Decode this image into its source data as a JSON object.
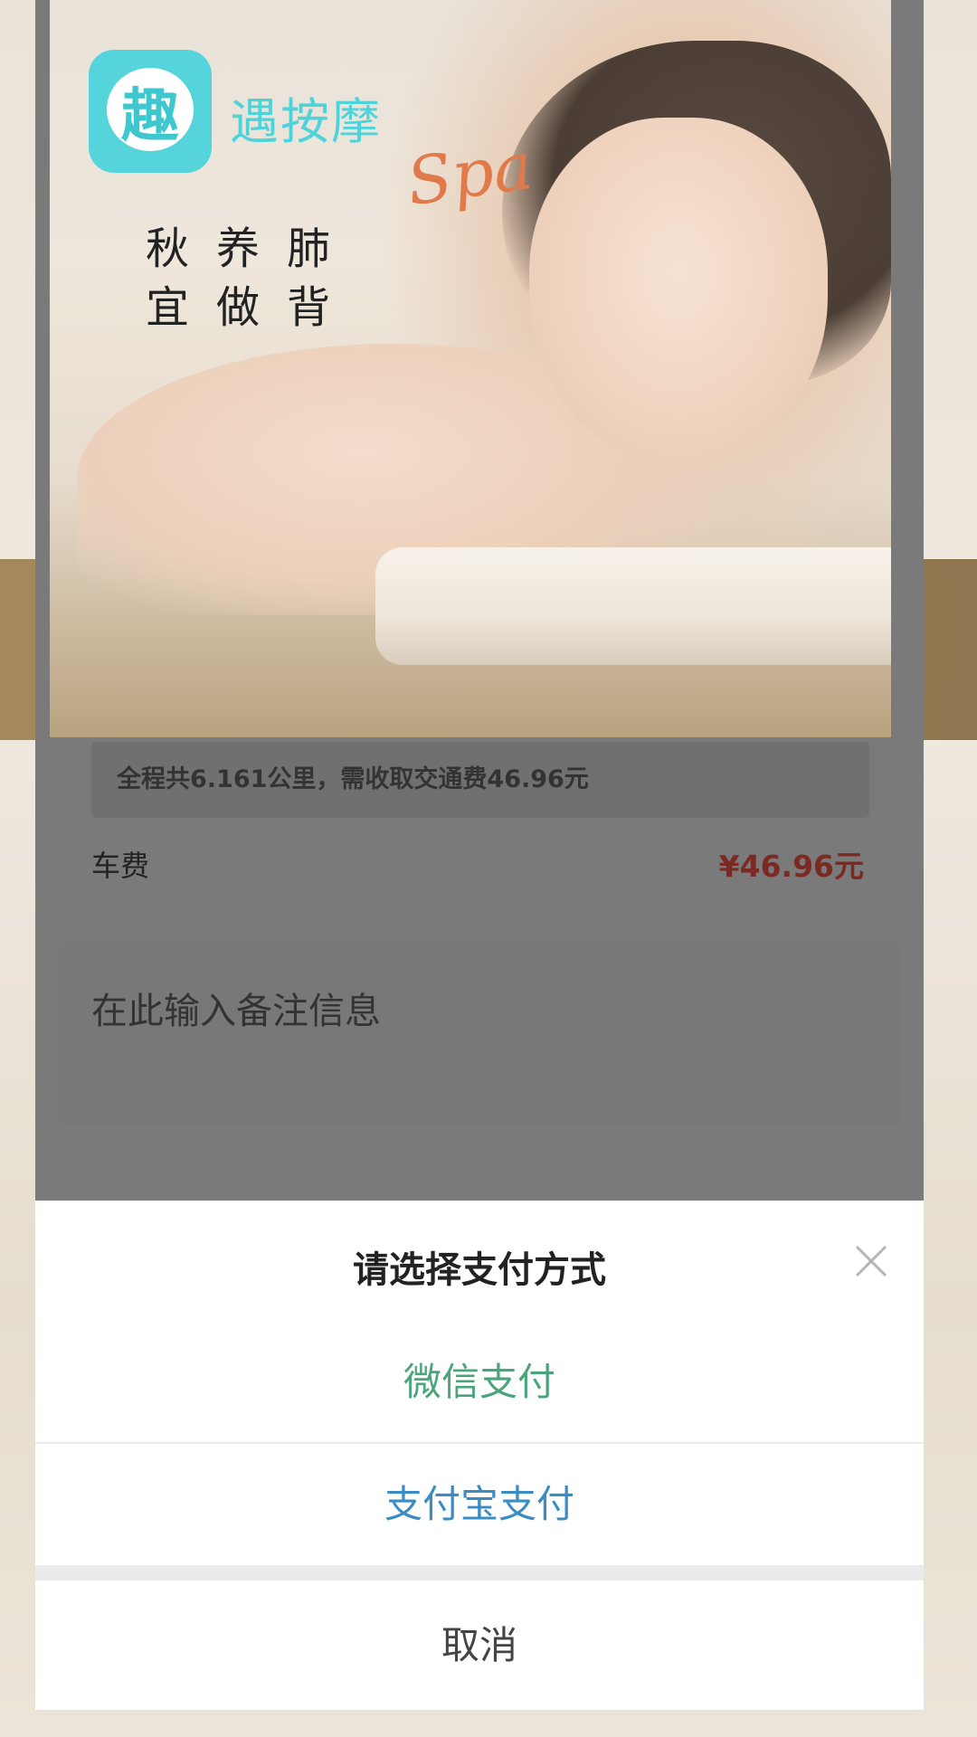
{
  "banner": {
    "brand_name": "遇按摩",
    "logo_glyph": "趣",
    "slogan_line1": "秋养肺",
    "slogan_line2": "宜做背",
    "script_text": "Spa"
  },
  "order": {
    "notice_text": "全程共6.161公里，需收取交通费46.96元",
    "fee_label": "车费",
    "fee_value": "¥46.96元",
    "remark_placeholder": "在此输入备注信息"
  },
  "payment_sheet": {
    "title": "请选择支付方式",
    "close_icon": "close-icon",
    "options": [
      {
        "label": "微信支付",
        "color": "#4aa67a"
      },
      {
        "label": "支付宝支付",
        "color": "#3c8cc4"
      }
    ],
    "cancel_label": "取消"
  },
  "colors": {
    "brand": "#55d4db",
    "price": "#7a2a22",
    "overlay": "#7a7a7a"
  }
}
